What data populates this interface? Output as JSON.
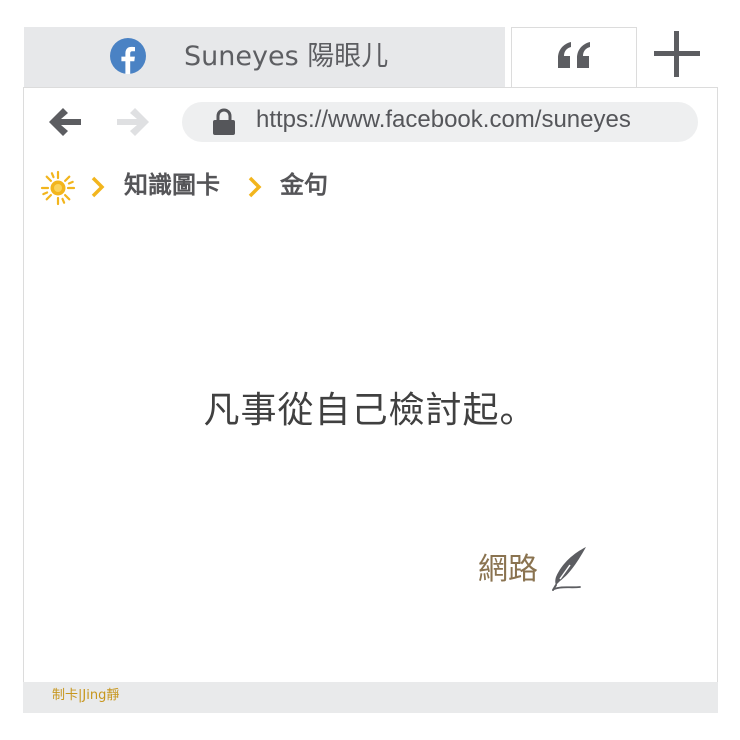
{
  "tab": {
    "title": "Suneyes 陽眼儿",
    "icon": "facebook-icon",
    "quote_tab_icon": "quote-icon",
    "new_tab_icon": "plus-icon"
  },
  "toolbar": {
    "back_icon": "arrow-left-icon",
    "forward_icon": "arrow-right-icon",
    "lock_icon": "lock-icon",
    "url": "https://www.facebook.com/suneyes"
  },
  "breadcrumb": {
    "home_icon": "sun-icon",
    "items": [
      "知識圖卡",
      "金句"
    ]
  },
  "content": {
    "quote": "凡事從自己檢討起。",
    "attribution": "網路",
    "attribution_icon": "quill-icon"
  },
  "footer": {
    "credit": "制卡|Jing靜"
  },
  "colors": {
    "tab_active_bg": "#e7e8ea",
    "facebook_blue": "#4a82c4",
    "chevron_yellow": "#f2b51d",
    "attribution_brown": "#8a7350",
    "credit_gold": "#c7961d",
    "icon_dark_gray": "#5c5d61",
    "icon_light_gray": "#dfe0e2"
  }
}
